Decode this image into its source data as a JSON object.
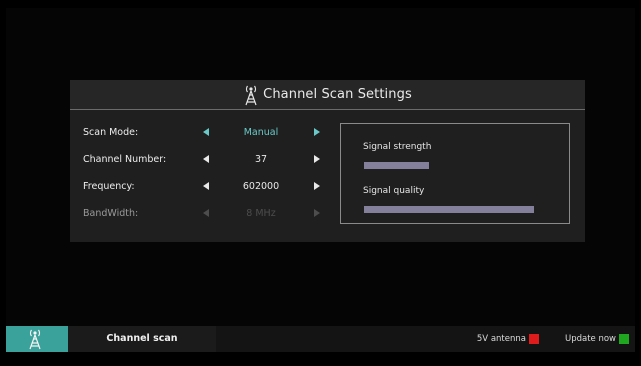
{
  "dialog": {
    "title": "Channel Scan Settings",
    "icon": "antenna-tower-icon"
  },
  "settings": [
    {
      "label": "Scan Mode:",
      "value": "Manual",
      "state": "active"
    },
    {
      "label": "Channel Number:",
      "value": "37",
      "state": "normal"
    },
    {
      "label": "Frequency:",
      "value": "602000",
      "state": "normal"
    },
    {
      "label": "BandWidth:",
      "value": "8 MHz",
      "state": "disabled"
    }
  ],
  "signal": {
    "strength_label": "Signal strength",
    "strength_level": 0.38,
    "quality_label": "Signal quality",
    "quality_level": 1.0,
    "bar_color": "#847f9a"
  },
  "bottom_bar": {
    "title": "Channel scan",
    "icon": "antenna-tower-icon",
    "buttons": [
      {
        "label": "5V antenna",
        "color": "#e01b1b"
      },
      {
        "label": "Update now",
        "color": "#1fa81f"
      }
    ]
  },
  "colors": {
    "accent": "#6ac9c8",
    "tab_teal": "#3aa29b"
  }
}
